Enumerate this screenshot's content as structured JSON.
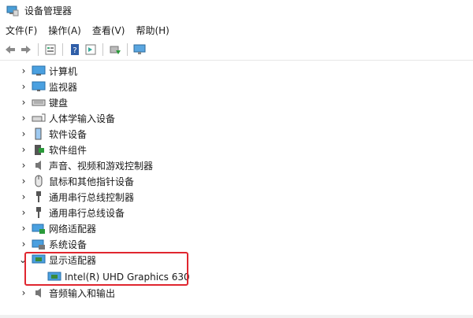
{
  "window": {
    "title": "设备管理器"
  },
  "menu": [
    "文件(F)",
    "操作(A)",
    "查看(V)",
    "帮助(H)"
  ],
  "toolbar": [
    "back-icon",
    "forward-icon",
    "properties-icon",
    "help-icon",
    "driver-details-icon",
    "update-driver-icon",
    "scan-hardware-icon"
  ],
  "tree": {
    "items": [
      {
        "label": "计算机",
        "icon": "computer-icon",
        "expanded": false
      },
      {
        "label": "监视器",
        "icon": "monitor-icon",
        "expanded": false
      },
      {
        "label": "键盘",
        "icon": "keyboard-icon",
        "expanded": false
      },
      {
        "label": "人体学输入设备",
        "icon": "hid-icon",
        "expanded": false
      },
      {
        "label": "软件设备",
        "icon": "software-device-icon",
        "expanded": false
      },
      {
        "label": "软件组件",
        "icon": "software-component-icon",
        "expanded": false
      },
      {
        "label": "声音、视频和游戏控制器",
        "icon": "speaker-icon",
        "expanded": false
      },
      {
        "label": "鼠标和其他指针设备",
        "icon": "mouse-icon",
        "expanded": false
      },
      {
        "label": "通用串行总线控制器",
        "icon": "usb-icon",
        "expanded": false
      },
      {
        "label": "通用串行总线设备",
        "icon": "usb-icon",
        "expanded": false
      },
      {
        "label": "网络适配器",
        "icon": "network-icon",
        "expanded": false
      },
      {
        "label": "系统设备",
        "icon": "system-icon",
        "expanded": false
      },
      {
        "label": "显示适配器",
        "icon": "display-adapter-icon",
        "expanded": true
      },
      {
        "label": "Intel(R) UHD Graphics 630",
        "icon": "display-adapter-icon",
        "child": true
      },
      {
        "label": "音频输入和输出",
        "icon": "audio-io-icon",
        "expanded": false
      }
    ]
  },
  "colors": {
    "highlight": "#e0262f"
  }
}
